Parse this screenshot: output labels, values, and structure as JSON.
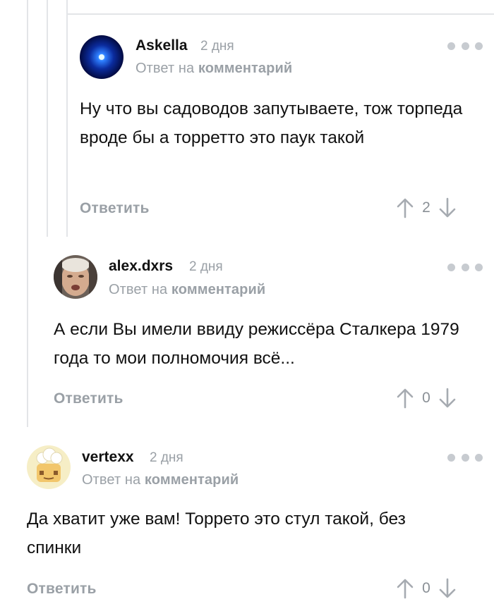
{
  "comments": [
    {
      "author": "Askella",
      "time": "2 дня",
      "reply_prefix": "Ответ на ",
      "reply_link": "комментарий",
      "text": "Ну что вы садоводов запутываете, тож торпеда вроде бы а торретто это паук такой",
      "reply_label": "Ответить",
      "score": "2"
    },
    {
      "author": "alex.dxrs",
      "time": "2 дня",
      "reply_prefix": "Ответ на ",
      "reply_link": "комментарий",
      "text": "А если Вы имели ввиду режиссёра Сталкера 1979 года то мои полномочия всё...",
      "reply_label": "Ответить",
      "score": "0"
    },
    {
      "author": "vertexx",
      "time": "2 дня",
      "reply_prefix": "Ответ на ",
      "reply_link": "комментарий",
      "text": "Да хватит уже вам! Торрето это стул такой, без спинки",
      "reply_label": "Ответить",
      "score": "0"
    }
  ],
  "icons": {
    "more": "more-dots-icon",
    "upvote": "arrow-up-icon",
    "downvote": "arrow-down-icon"
  },
  "colors": {
    "muted": "#9aa0a6",
    "thread_line": "#e3e5e8",
    "text": "#111111"
  }
}
